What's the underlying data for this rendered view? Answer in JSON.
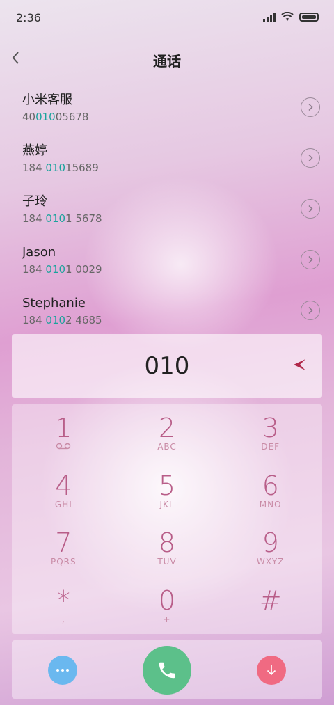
{
  "status": {
    "time": "2:36"
  },
  "header": {
    "title": "通话"
  },
  "results": [
    {
      "name": "小米客服",
      "number_parts": [
        "40",
        "010",
        "05678"
      ]
    },
    {
      "name": "燕婷",
      "number_parts": [
        "184 ",
        "010",
        "15689"
      ]
    },
    {
      "name": "子玲",
      "number_parts": [
        "184 ",
        "010",
        "1 5678"
      ]
    },
    {
      "name": "Jason",
      "number_parts": [
        "184 ",
        "010",
        "1 0029"
      ]
    },
    {
      "name": "Stephanie",
      "number_parts": [
        "184 ",
        "010",
        "2 4685"
      ]
    }
  ],
  "dial": {
    "input": "010"
  },
  "keypad": [
    {
      "num": "1",
      "letters": ""
    },
    {
      "num": "2",
      "letters": "ABC"
    },
    {
      "num": "3",
      "letters": "DEF"
    },
    {
      "num": "4",
      "letters": "GHI"
    },
    {
      "num": "5",
      "letters": "JKL"
    },
    {
      "num": "6",
      "letters": "MNO"
    },
    {
      "num": "7",
      "letters": "PQRS"
    },
    {
      "num": "8",
      "letters": "TUV"
    },
    {
      "num": "9",
      "letters": "WXYZ"
    },
    {
      "num": "*",
      "letters": ","
    },
    {
      "num": "0",
      "letters": "+"
    },
    {
      "num": "#",
      "letters": ""
    }
  ],
  "icons": {
    "back": "chevron-left-icon",
    "detail": "chevron-right-circle-icon",
    "backspace": "backspace-arrow-icon",
    "voicemail": "voicemail-icon",
    "menu": "more-dots-icon",
    "call": "phone-icon",
    "collapse": "arrow-down-icon"
  },
  "colors": {
    "highlight": "#1aa39c",
    "key": "#b85d88",
    "menu_button": "#6ab8ef",
    "call_button": "#5cc08a",
    "collapse_button": "#f06a82"
  }
}
